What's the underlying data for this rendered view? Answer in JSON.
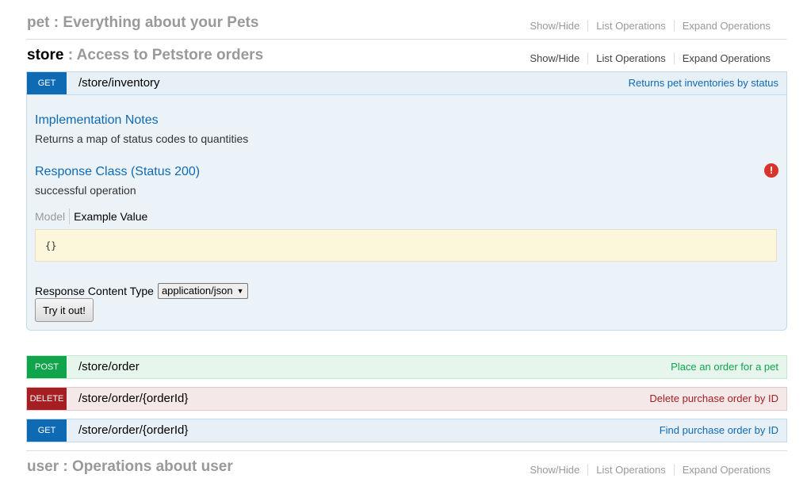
{
  "pet": {
    "name": "pet",
    "sep": " : ",
    "description": "Everything about your Pets",
    "show_hide": "Show/Hide",
    "list_ops": "List Operations",
    "expand_ops": "Expand Operations"
  },
  "store": {
    "name": "store",
    "sep": " : ",
    "description": "Access to Petstore orders",
    "show_hide": "Show/Hide",
    "list_ops": "List Operations",
    "expand_ops": "Expand Operations"
  },
  "user": {
    "name": "user",
    "sep": " : ",
    "description": "Operations about user",
    "show_hide": "Show/Hide",
    "list_ops": "List Operations",
    "expand_ops": "Expand Operations"
  },
  "inventory": {
    "method": "GET",
    "path": "/store/inventory",
    "summary": "Returns pet inventories by status",
    "impl_title": "Implementation Notes",
    "impl_text": "Returns a map of status codes to quantities",
    "resp_title": "Response Class (Status 200)",
    "resp_text": "successful operation",
    "tab_model": "Model",
    "tab_example": "Example Value",
    "example": "{}",
    "content_type_label": "Response Content Type",
    "content_type_value": "application/json",
    "try_label": "Try it out!",
    "error_icon": "!"
  },
  "ops": [
    {
      "method": "POST",
      "path": "/store/order",
      "summary": "Place an order for a pet"
    },
    {
      "method": "DELETE",
      "path": "/store/order/{orderId}",
      "summary": "Delete purchase order by ID"
    },
    {
      "method": "GET",
      "path": "/store/order/{orderId}",
      "summary": "Find purchase order by ID"
    }
  ],
  "colors": {
    "get": "#0f6ab4",
    "post": "#10a54a",
    "delete": "#a41e22"
  }
}
